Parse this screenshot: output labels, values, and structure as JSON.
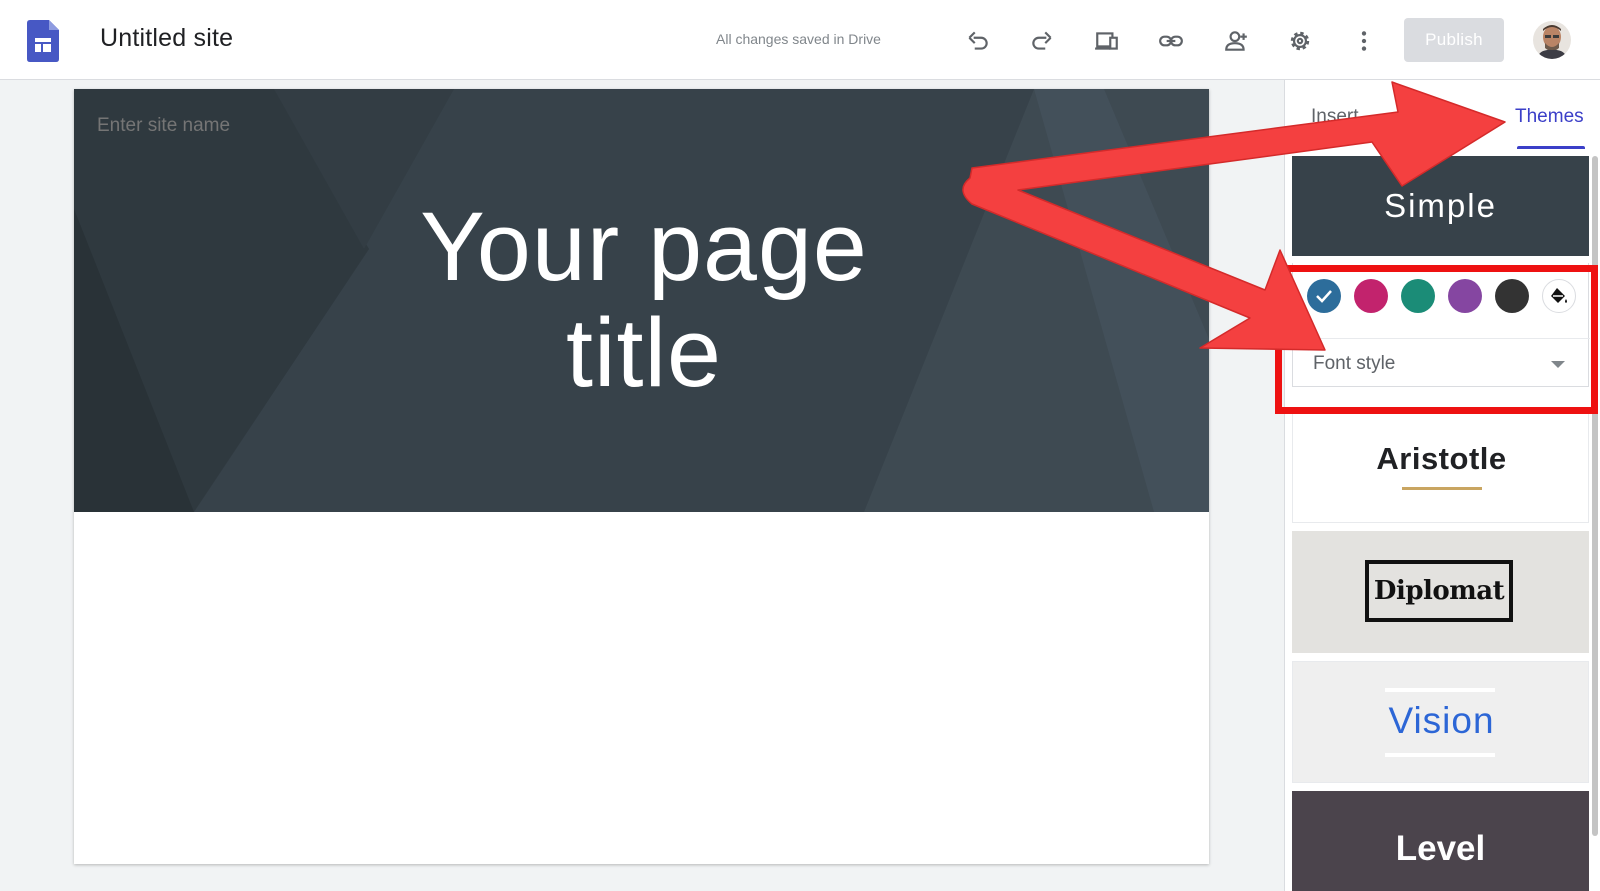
{
  "header": {
    "app_icon": "google-sites-logo",
    "site_title": "Untitled site",
    "save_status": "All changes saved in Drive",
    "tools": [
      {
        "name": "undo-icon"
      },
      {
        "name": "redo-icon"
      },
      {
        "name": "preview-devices-icon"
      },
      {
        "name": "link-icon"
      },
      {
        "name": "share-person-add-icon"
      },
      {
        "name": "settings-gear-icon"
      },
      {
        "name": "more-vert-icon"
      }
    ],
    "publish_label": "Publish"
  },
  "canvas": {
    "site_name_placeholder": "Enter site name",
    "page_title_line1": "Your page",
    "page_title_line2": "title",
    "hero_color": "#37424a"
  },
  "panel": {
    "tabs": [
      {
        "label": "Insert",
        "active": false
      },
      {
        "label": "Themes",
        "active": true
      }
    ],
    "themes": {
      "simple": {
        "label": "Simple",
        "selected": true
      },
      "aristotle": {
        "label": "Aristotle"
      },
      "diplomat": {
        "label": "Diplomat"
      },
      "vision": {
        "label": "Vision"
      },
      "level": {
        "label": "Level"
      }
    },
    "color_swatches": [
      {
        "color": "#2d6d9b",
        "selected": true,
        "name": "blue"
      },
      {
        "color": "#c2236d",
        "selected": false,
        "name": "pink"
      },
      {
        "color": "#1b8c77",
        "selected": false,
        "name": "teal"
      },
      {
        "color": "#8546a1",
        "selected": false,
        "name": "purple"
      },
      {
        "color": "#333333",
        "selected": false,
        "name": "dark-gray"
      }
    ],
    "custom_color_icon": "paint-bucket-icon",
    "font_style_label": "Font style"
  },
  "annotation": {
    "arrow_color": "#f44040",
    "highlight_color": "#ee1111"
  }
}
